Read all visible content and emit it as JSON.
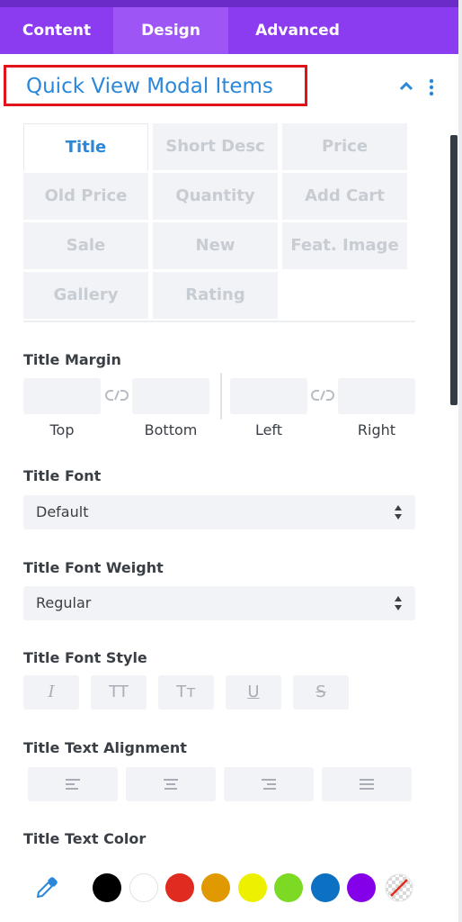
{
  "tabs": {
    "content": "Content",
    "design": "Design",
    "advanced": "Advanced"
  },
  "section": {
    "title": "Quick View Modal Items"
  },
  "subtabs": [
    "Title",
    "Short Desc",
    "Price",
    "Old Price",
    "Quantity",
    "Add Cart",
    "Sale",
    "New",
    "Feat. Image",
    "Gallery",
    "Rating"
  ],
  "margin": {
    "label": "Title Margin",
    "top": "Top",
    "bottom": "Bottom",
    "left": "Left",
    "right": "Right"
  },
  "font": {
    "label": "Title Font",
    "value": "Default"
  },
  "weight": {
    "label": "Title Font Weight",
    "value": "Regular"
  },
  "style": {
    "label": "Title Font Style",
    "buttons": [
      "I",
      "TT",
      "Tт",
      "U",
      "S"
    ]
  },
  "alignment": {
    "label": "Title Text Alignment"
  },
  "color": {
    "label": "Title Text Color",
    "swatches": [
      "#000000",
      "#ffffff",
      "#e02b20",
      "#e09900",
      "#edf000",
      "#7cda24",
      "#0c71c3",
      "#8300e9"
    ]
  },
  "colors": {
    "accent": "#8b3cf0",
    "link": "#2b87da",
    "highlight_border": "#e0131b"
  },
  "icons": {
    "collapse": "chevron-up-icon",
    "menu": "kebab-menu-icon",
    "link": "link-icon",
    "eyedropper": "eyedropper-icon",
    "reset": "no-color-icon"
  }
}
